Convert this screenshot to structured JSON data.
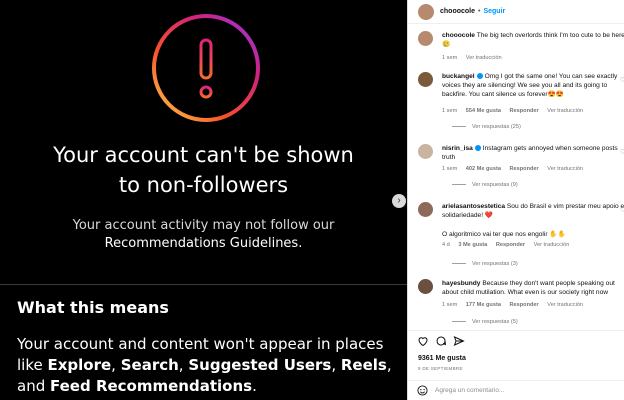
{
  "media": {
    "headline_1": "Your account can't be shown",
    "headline_2": "to non-followers",
    "sub_1": "Your account activity may not follow our",
    "sub_2": "Recommendations Guidelines.",
    "means_title": "What this means",
    "means_body_1": "Your account and content won't appear in places",
    "means_body_2_prefix": "like ",
    "explore": "Explore",
    "search": "Search",
    "suggested": "Suggested Users",
    "reels": "Reels",
    "and_word": "and ",
    "feed": "Feed Recommendations",
    "sep": ", ",
    "end": ".",
    "warning_icon": "exclamation-circle-icon",
    "next_icon": "chevron-right-icon"
  },
  "post": {
    "author": "chooocole",
    "dot": "•",
    "follow_label": "Seguir",
    "caption": "The big tech overlords think I'm too cute to be here. 🥲",
    "caption_time": "1 sem",
    "caption_translate": "Ver traducción"
  },
  "comments": [
    {
      "user": "buckangel",
      "text": "Omg I got the same one! You can see exactly voices they are silencing! We see you all and its going to backfire. You cant silence us forever😍😍",
      "time": "1 sem",
      "likes": "554 Me gusta",
      "reply": "Responder",
      "translate": "Ver traducción",
      "replies": "Ver respuestas (25)"
    },
    {
      "user": "nisrin_isa",
      "text": "Instagram gets annoyed when someone posts truth",
      "time": "1 sem",
      "likes": "402 Me gusta",
      "reply": "Responder",
      "translate": "Ver traducción",
      "replies": "Ver respuestas (9)"
    },
    {
      "user": "arielasantosestetica",
      "text": "Sou do Brasil e vim prestar meu apoio e solidariedade! ❤️",
      "text2": "O algoritmico vai ter que nos engolir ✋✋",
      "time": "4 d",
      "likes": "3 Me gusta",
      "reply": "Responder",
      "translate": "Ver traducción",
      "replies": "Ver respuestas (3)"
    },
    {
      "user": "hayesbundy",
      "text": "Because they don't want people speaking out about child mutilation. What even is our society right now",
      "time": "1 sem",
      "likes": "177 Me gusta",
      "reply": "Responder",
      "translate": "Ver traducción",
      "replies": "Ver respuestas (5)"
    }
  ],
  "footer": {
    "likes": "9361 Me gusta",
    "date": "9 DE SEPTIEMBRE",
    "comment_placeholder": "Agrega un comentario..."
  }
}
